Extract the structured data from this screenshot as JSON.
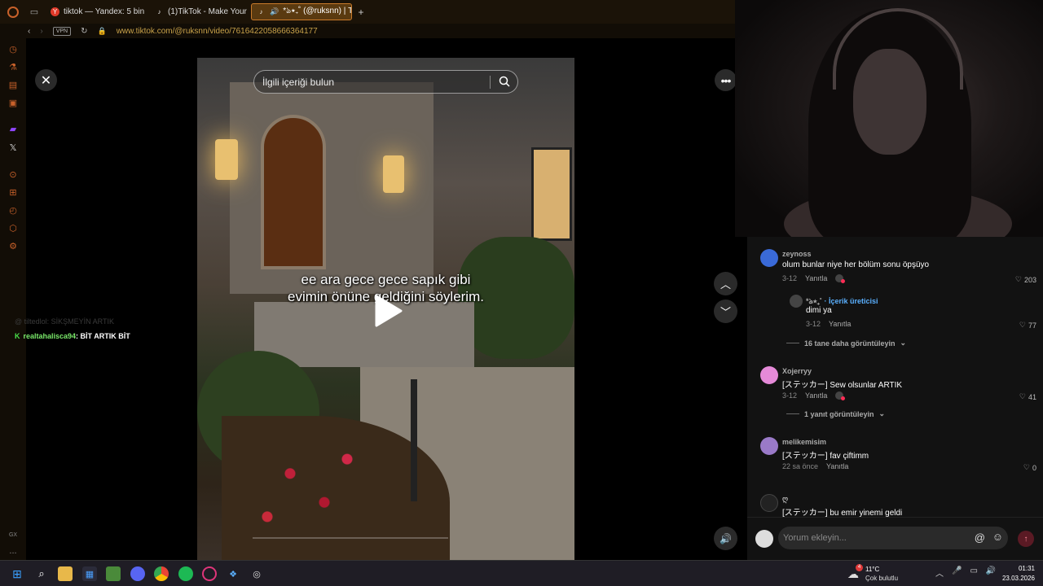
{
  "browser": {
    "tabs": [
      {
        "label": "tiktok — Yandex: 5 bin son",
        "favicon": "Y",
        "favicon_color": "#e03a2a"
      },
      {
        "label": "(1)TikTok - Make Your Day",
        "favicon": "♪",
        "favicon_color": "#111"
      },
      {
        "label": "*ঌ⭑₊˚ (@ruksnn) | Ti",
        "favicon": "♪",
        "favicon_color": "#111"
      }
    ],
    "vpn_label": "VPN",
    "url": "www.tiktok.com/@ruksnn/video/7616422058666364177"
  },
  "video": {
    "search_placeholder": "İlgili içeriği bulun",
    "caption_line1": "ee ara gece gece sapık gibi",
    "caption_line2": "evimin önüne geldiğini söylerim."
  },
  "chat": {
    "faded_line": "@ tiltedlol: SİKŞMEYİN ARTIK",
    "username": "realtahalisca94",
    "message": ": BİT ARTIK BİT"
  },
  "comments": [
    {
      "user": "zeynoss",
      "text": "olum bunlar niye her bölüm sonu öpşüyo",
      "date": "3-12",
      "reply": "Yanıtla",
      "likes": "203",
      "avatar_color": "#3a6ad8"
    },
    {
      "user": "*ঌ⭑₊˚",
      "creator_tag": "· İçerik üreticisi",
      "text": "dimi ya",
      "date": "3-12",
      "reply": "Yanıtla",
      "likes": "77",
      "avatar_color": "#444"
    },
    {
      "more": "16 tane daha görüntüleyin"
    },
    {
      "user": "Xojerryy",
      "text": "[ステッカー] Sew olsunlar ARTIK",
      "date": "3-12",
      "reply": "Yanıtla",
      "likes": "41",
      "avatar_color": "#e58ad8"
    },
    {
      "more": "1 yanıt görüntüleyin"
    },
    {
      "user": "melikemisim",
      "text": "[ステッカー] fav çiftimm",
      "date": "22 sa önce",
      "reply": "Yanıtla",
      "likes": "0",
      "avatar_color": "#9a7ac8"
    },
    {
      "user": "ღ",
      "text": "[ステッカー] bu emir yinemi geldi",
      "avatar_color": "#222"
    }
  ],
  "comment_input": {
    "placeholder": "Yorum ekleyin..."
  },
  "taskbar": {
    "weather_temp": "11°C",
    "weather_cond": "Çok bulutlu",
    "weather_badge": "4",
    "time": "01:31",
    "date": "23.03.2026"
  },
  "sidebar": {
    "gx_label": "GX",
    "more_label": "..."
  }
}
